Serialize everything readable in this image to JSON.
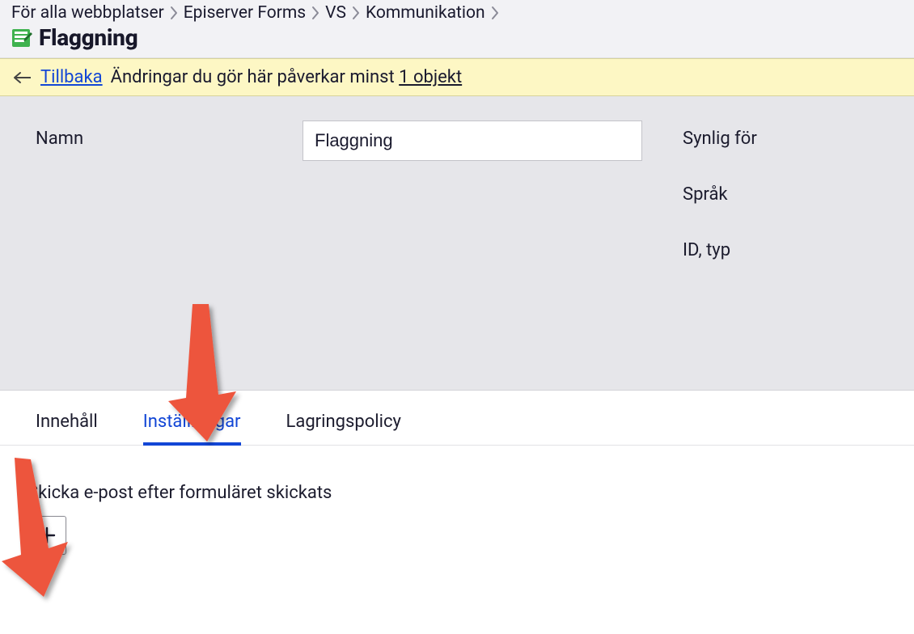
{
  "breadcrumb": {
    "items": [
      "För alla webbplatser",
      "Episerver Forms",
      "VS",
      "Kommunikation"
    ]
  },
  "page": {
    "title": "Flaggning"
  },
  "notice": {
    "back_label": "Tillbaka",
    "message_prefix": "Ändringar du gör här påverkar minst ",
    "objects_link": "1 objekt"
  },
  "form": {
    "name_label": "Namn",
    "name_value": "Flaggning"
  },
  "meta": {
    "visible_for_label": "Synlig för",
    "language_label": "Språk",
    "id_type_label": "ID, typ"
  },
  "tabs": {
    "content": "Innehåll",
    "settings": "Inställningar",
    "storage": "Lagringspolicy"
  },
  "settings": {
    "email_section_label": "Skicka e-post efter formuläret skickats"
  },
  "colors": {
    "accent": "#1246d6",
    "notice_bg": "#fdf7c4",
    "gray_bg": "#e6e6ea",
    "annotation": "#ed543e"
  }
}
